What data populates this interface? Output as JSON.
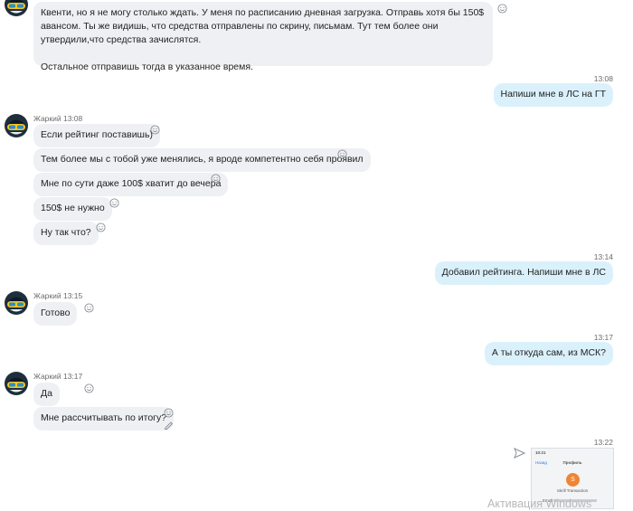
{
  "messages": {
    "m0": "Квенти, но я не могу столько ждать. У меня по расписанию дневная загрузка. Отправь хотя бы 150$ авансом. Ты же видишь, что средства отправлены по скрину, письмам. Тут тем более они утвердили,что средства зачислятся.",
    "m0b": "Остальное отправишь тогда в указанное время.",
    "t1": "13:08",
    "o1": "Напиши мне в ЛС на ГТ",
    "s1": "Жаркий 13:08",
    "i1": "Если рейтинг поставишь)",
    "i2": "Тем более мы с тобой уже менялись, я вроде компетентно себя проявил",
    "i3": "Мне по сути даже 100$ хватит до вечера",
    "i4": "150$ не нужно",
    "i5": "Ну так что?",
    "t2": "13:14",
    "o2": "Добавил рейтинга. Напиши мне в ЛС",
    "s2": "Жаркий 13:15",
    "i6": "Готово",
    "t3": "13:17",
    "o3": "А ты откуда сам, из МСК?",
    "s3": "Жаркий 13:17",
    "i7": "Да",
    "i8": "Мне рассчитывать по итогу?",
    "t4": "13:22"
  },
  "attachment": {
    "status_time": "10:21",
    "back": "Назад",
    "title": "Профиль",
    "initial": "S",
    "name": "Skrill Transaction",
    "email_label": "Email"
  },
  "watermark": "Активация Windows",
  "icons": {
    "avatar": "ski-goggles-avatar",
    "reaction": "smiley-reaction-icon",
    "send": "send-arrow-icon",
    "edit": "pencil-icon"
  },
  "colors": {
    "incoming": "#eef0f3",
    "outgoing": "#daf1fb",
    "avatar_bg": "#1f2e3d",
    "goggles": "#f3c623"
  }
}
